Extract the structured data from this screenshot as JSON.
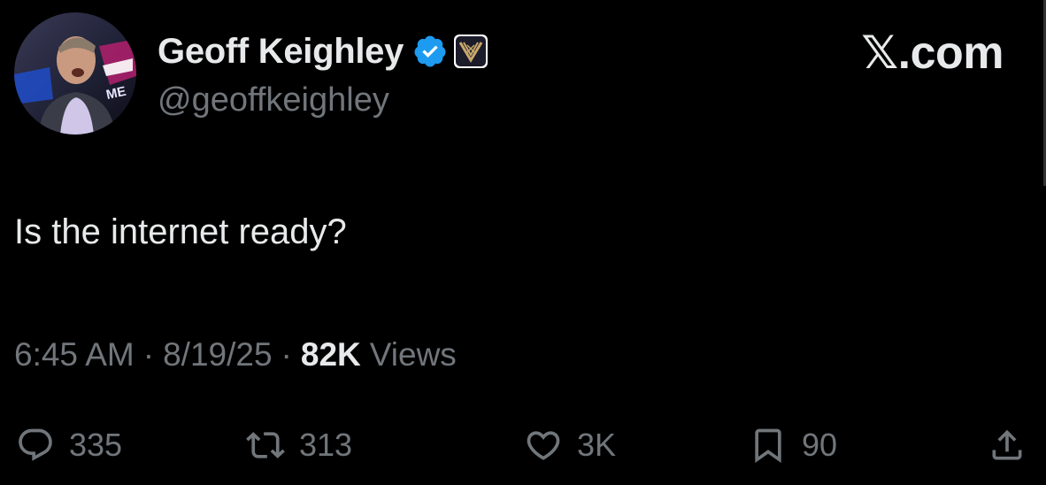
{
  "brand": {
    "logo_text": "𝕏.com"
  },
  "author": {
    "display_name": "Geoff Keighley",
    "handle": "@geoffkeighley",
    "verified_color": "#1d9bf0",
    "affiliate_badge_color": "#c8a86b",
    "avatar_backdrop_text": "ME"
  },
  "tweet": {
    "text": "Is the internet ready?"
  },
  "meta": {
    "time": "6:45 AM",
    "separator": "·",
    "date": "8/19/25",
    "views_count": "82K",
    "views_label": "Views"
  },
  "actions": {
    "reply_count": "335",
    "repost_count": "313",
    "like_count": "3K",
    "bookmark_count": "90"
  },
  "icons": [
    "reply-icon",
    "repost-icon",
    "like-icon",
    "bookmark-icon",
    "share-icon",
    "verified-badge-icon",
    "affiliate-badge-icon"
  ]
}
